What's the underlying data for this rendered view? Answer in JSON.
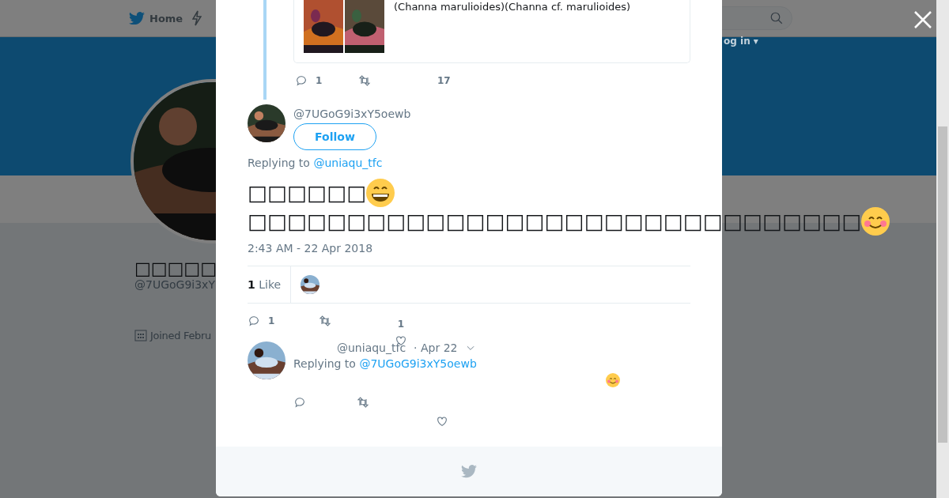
{
  "nav": {
    "home": "Home",
    "login": "og in ▾"
  },
  "profile": {
    "name": "□□□□□",
    "handle": "@7UGoG9i3xY",
    "joined": "Joined Febru"
  },
  "quoted": {
    "text": "(Channa marulioides)(Channa cf. marulioides)",
    "replies": "1",
    "likes": "17"
  },
  "tweet": {
    "handle": "@7UGoG9i3xY5oewb",
    "follow": "Follow",
    "replying_label": "Replying to",
    "replying_to": "@uniaqu_tfc",
    "lines": [
      "□□□□□□",
      "□□□□□□□□□□□□□□□□□□□□□□□□□□□□□□□"
    ],
    "time": "2:43 AM - 22 Apr 2018",
    "like_count": "1",
    "like_label": "Like",
    "replies": "1",
    "likes": "1"
  },
  "reply": {
    "handle": "@uniaqu_tfc",
    "date": "· Apr 22",
    "replying_label": "Replying to",
    "replying_to": "@7UGoG9i3xY5oewb"
  }
}
